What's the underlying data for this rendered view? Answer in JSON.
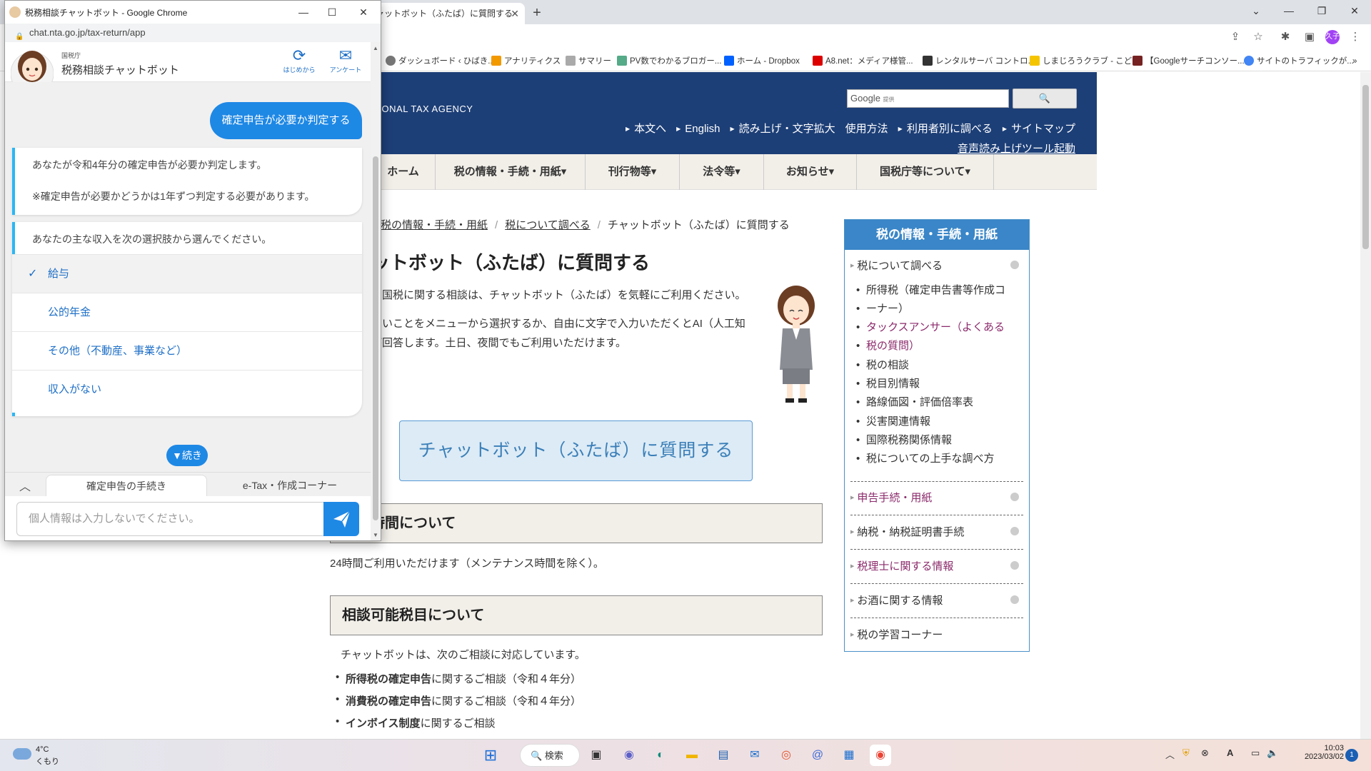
{
  "browser": {
    "active_tab_title": "ャットボット（ふたば）に質問する",
    "bookmarks": [
      "ダッシュボード ‹ ひばき...",
      "アナリティクス",
      "サマリー",
      "PV数でわかるブロガー...",
      "ホーム - Dropbox",
      "A8.net：メディア様管...",
      "レンタルサーバ コントロ...",
      "しまじろうクラブ - こど...",
      "【Googleサーチコンソー...",
      "サイトのトラフィックが..."
    ],
    "profile_initial": "久子"
  },
  "nta": {
    "agency_name": "TIONAL TAX AGENCY",
    "search_placeholder": "Google",
    "search_provided": "提供",
    "search_button": "🔍",
    "header_links": [
      "本文へ",
      "English",
      "読み上げ・文字拡大",
      "使用方法",
      "利用者別に調べる",
      "サイトマップ"
    ],
    "voice_tool": "音声読み上げツール起動",
    "nav": [
      "ホーム",
      "税の情報・手続・用紙▾",
      "刊行物等▾",
      "法令等▾",
      "お知らせ▾",
      "国税庁等について▾"
    ],
    "breadcrumb": [
      "税の情報・手続・用紙",
      "税について調べる",
      "チャットボット（ふたば）に質問する"
    ],
    "heading": "ットボット（ふたば）に質問する",
    "intro_1": "の国税に関する相談は、チャットボット（ふたば）を気軽にご利用ください。",
    "intro_2": "たいことをメニューから選択するか、自由に文字で入力いただくとAI（人工知",
    "intro_3": "が回答します。土日、夜間でもご利用いただけます。",
    "cta": "チャットボット（ふたば）に質問する",
    "section1_title": "可能時間について",
    "section1_text": "24時間ご利用いただけます（メンテナンス時間を除く）。",
    "section2_title": "相談可能税目について",
    "section2_text": "チャットボットは、次のご相談に対応しています。",
    "bullets": [
      {
        "bold": "所得税の確定申告",
        "rest": "に関するご相談（令和４年分）"
      },
      {
        "bold": "消費税の確定申告",
        "rest": "に関するご相談（令和４年分）"
      },
      {
        "bold": "インボイス制度",
        "rest": "に関するご相談"
      }
    ],
    "sidebar": {
      "title": "税の情報・手続・用紙",
      "section_1": "税について調べる",
      "items": [
        "所得税（確定申告書等作成コ",
        "ーナー）",
        "タックスアンサー（よくある",
        "税の質問）",
        "税の相談",
        "税目別情報",
        "路線価図・評価倍率表",
        "災害関連情報",
        "国際税務関係情報",
        "税についての上手な調べ方"
      ],
      "section_2": "申告手続・用紙",
      "section_3": "納税・納税証明書手続",
      "section_4": "税理士に関する情報",
      "section_5": "お酒に関する情報",
      "section_6": "税の学習コーナー"
    }
  },
  "chat": {
    "window_title": "税務相談チャットボット - Google Chrome",
    "url": "chat.nta.go.jp/tax-return/app",
    "agency_small": "国税庁",
    "bot_name": "税務相談チャットボット",
    "restart_label": "はじめから",
    "survey_label": "アンケート",
    "user_message": "確定申告が必要か判定する",
    "bot_message_1": "あなたが令和4年分の確定申告が必要か判定します。",
    "bot_message_2": "※確定申告が必要かどうかは1年ずつ判定する必要があります。",
    "bot_question": "あなたの主な収入を次の選択肢から選んでください。",
    "options": [
      "給与",
      "公的年金",
      "その他（不動産、事業など）",
      "収入がない"
    ],
    "selected_option": "給与",
    "more_button": "▼続き",
    "tab_1": "確定申告の手続き",
    "tab_2": "e-Tax・作成コーナー",
    "input_placeholder": "個人情報は入力しないでください。"
  },
  "taskbar": {
    "temperature": "4°C",
    "weather": "くもり",
    "search_label": "検索",
    "time": "10:03",
    "date": "2023/03/02",
    "notifications": "1",
    "ime": "A"
  }
}
